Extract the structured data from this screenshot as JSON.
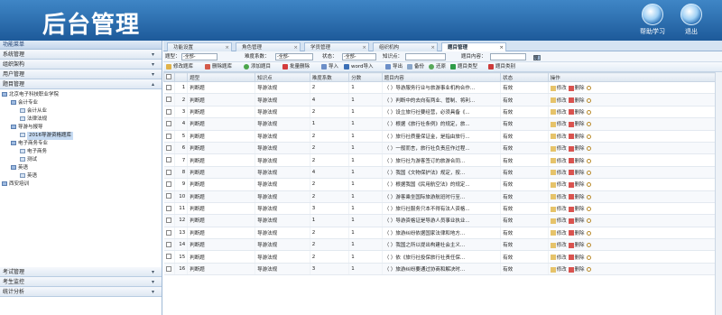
{
  "header": {
    "title": "后台管理",
    "buttons": [
      "帮助学习",
      "退出"
    ]
  },
  "sidebar": {
    "title": "功能菜单",
    "top_items": [
      "系统管理",
      "组织架构",
      "用户管理",
      "题目管理"
    ],
    "tree": [
      {
        "label": "北京电子科技职业学院",
        "level": 0
      },
      {
        "label": "会计专业",
        "level": 1
      },
      {
        "label": "会计从业",
        "level": 2
      },
      {
        "label": "法律法规",
        "level": 2
      },
      {
        "label": "导游与报导",
        "level": 1
      },
      {
        "label": "2016导游资格题库",
        "level": 2,
        "selected": true
      },
      {
        "label": "电子商务专业",
        "level": 1
      },
      {
        "label": "电子商务",
        "level": 2
      },
      {
        "label": "测试",
        "level": 2
      },
      {
        "label": "英语",
        "level": 1
      },
      {
        "label": "英语",
        "level": 2
      },
      {
        "label": "西安培训",
        "level": 0
      }
    ],
    "bottom_items": [
      "考试管理",
      "考生监控",
      "统计分析"
    ]
  },
  "tabs": [
    "功能设置",
    "角色管理",
    "学员管理",
    "组织机构",
    "题目管理"
  ],
  "filter": {
    "type_label": "题型：",
    "type_value": "-全部-",
    "difficulty_label": "难度系数：",
    "difficulty_value": "-全部-",
    "status_label": "状态：",
    "status_value": "-全部-",
    "knowledge_label": "知识点：",
    "content_label": "题目内容：",
    "search_label": "搜 索"
  },
  "toolbar": [
    "修改题库",
    "删除题库",
    "添加题目",
    "批量删除",
    "导入",
    "word导入",
    "导出",
    "备份",
    "还原",
    "题目类型",
    "题目类别"
  ],
  "table": {
    "columns": [
      "",
      "",
      "题型",
      "知识点",
      "难度系数",
      "分数",
      "题目内容",
      "状态",
      "操作"
    ],
    "op_edit": "修改",
    "op_delete": "删除",
    "rows": [
      {
        "no": "1",
        "type": "判断题",
        "kp": "导游法规",
        "diff": "2",
        "score": "1",
        "content": "（ ）导游服务行业与旅游事业机构合作...",
        "status": "有效"
      },
      {
        "no": "2",
        "type": "判断题",
        "kp": "导游法规",
        "diff": "4",
        "score": "1",
        "content": "（ ）判断中的去向有两业、管制、将利...",
        "status": "有效"
      },
      {
        "no": "3",
        "type": "判断题",
        "kp": "导游法规",
        "diff": "2",
        "score": "1",
        "content": "（ ）设立旅行社要经营，必须具备《...",
        "status": "有效"
      },
      {
        "no": "4",
        "type": "判断题",
        "kp": "导游法规",
        "diff": "1",
        "score": "1",
        "content": "（ ）根据《旅行社条例》的规定，旅...",
        "status": "有效"
      },
      {
        "no": "5",
        "type": "判断题",
        "kp": "导游法规",
        "diff": "2",
        "score": "1",
        "content": "（ ）旅行社质量保证金，是指由旅行...",
        "status": "有效"
      },
      {
        "no": "6",
        "type": "判断题",
        "kp": "导游法规",
        "diff": "2",
        "score": "1",
        "content": "（ ）一般而言，旅行社负责应作过程...",
        "status": "有效"
      },
      {
        "no": "7",
        "type": "判断题",
        "kp": "导游法规",
        "diff": "2",
        "score": "1",
        "content": "（ ）旅行社为游客签订的旅游合同...",
        "status": "有效"
      },
      {
        "no": "8",
        "type": "判断题",
        "kp": "导游法规",
        "diff": "4",
        "score": "1",
        "content": "（ ）我国《文物保护法》规定，按...",
        "status": "有效"
      },
      {
        "no": "9",
        "type": "判断题",
        "kp": "导游法规",
        "diff": "2",
        "score": "1",
        "content": "（ ）根据我国《民用航空法》的规定...",
        "status": "有效"
      },
      {
        "no": "10",
        "type": "判断题",
        "kp": "导游法规",
        "diff": "2",
        "score": "1",
        "content": "（ ）游客乘坐国际旅游航班时行至...",
        "status": "有效"
      },
      {
        "no": "11",
        "type": "判断题",
        "kp": "导游法规",
        "diff": "3",
        "score": "1",
        "content": "（ ）旅行社服务只本不得有法人资格...",
        "status": "有效"
      },
      {
        "no": "12",
        "type": "判断题",
        "kp": "导游法规",
        "diff": "1",
        "score": "1",
        "content": "（ ）导游资格证是导游人员事业执业...",
        "status": "有效"
      },
      {
        "no": "13",
        "type": "判断题",
        "kp": "导游法规",
        "diff": "2",
        "score": "1",
        "content": "（ ）旅游纠纷依据国家法律和地方...",
        "status": "有效"
      },
      {
        "no": "14",
        "type": "判断题",
        "kp": "导游法规",
        "diff": "2",
        "score": "1",
        "content": "（ ）我国之所以提出构建社会主义...",
        "status": "有效"
      },
      {
        "no": "15",
        "type": "判断题",
        "kp": "导游法规",
        "diff": "2",
        "score": "1",
        "content": "（ ）依《旅行社投保旅行社责任保...",
        "status": "有效"
      },
      {
        "no": "16",
        "type": "判断题",
        "kp": "导游法规",
        "diff": "3",
        "score": "1",
        "content": "（ ）旅游纠纷要通过协商和解决时...",
        "status": "有效"
      }
    ]
  }
}
